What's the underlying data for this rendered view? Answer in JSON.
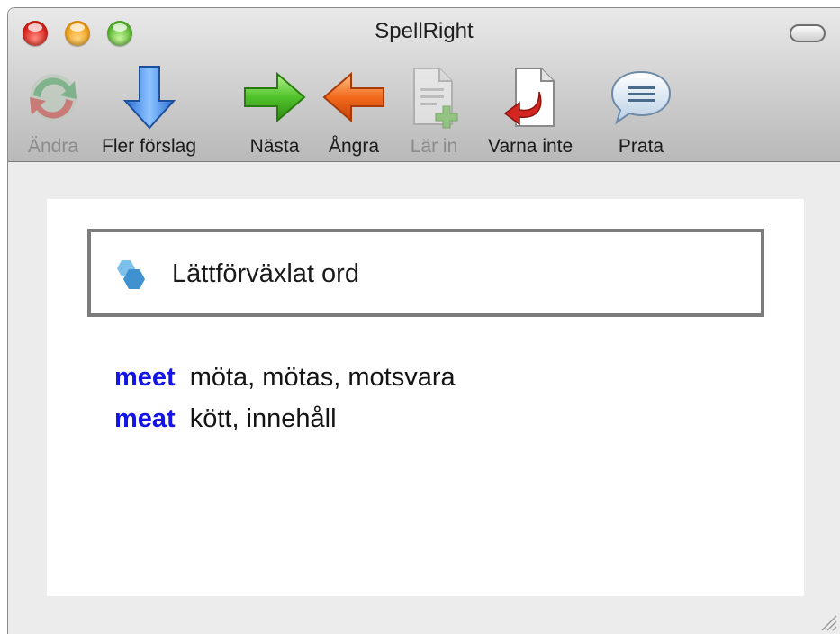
{
  "window": {
    "title": "SpellRight"
  },
  "toolbar": {
    "items": [
      {
        "label": "Ändra",
        "icon": "change-arrows-icon",
        "enabled": false
      },
      {
        "label": "Fler förslag",
        "icon": "down-arrow-icon",
        "enabled": true
      },
      {
        "label": "Nästa",
        "icon": "right-arrow-icon",
        "enabled": true
      },
      {
        "label": "Ångra",
        "icon": "left-arrow-icon",
        "enabled": true
      },
      {
        "label": "Lär in",
        "icon": "add-document-icon",
        "enabled": false
      },
      {
        "label": "Varna inte",
        "icon": "document-arrow-icon",
        "enabled": true
      },
      {
        "label": "Prata",
        "icon": "speech-bubble-icon",
        "enabled": true
      }
    ]
  },
  "panel": {
    "header": "Lättförväxlat ord",
    "header_icon": "hexagon-icon",
    "entries": [
      {
        "word": "meet",
        "translation": "möta, mötas, motsvara"
      },
      {
        "word": "meat",
        "translation": "kött, innehåll"
      }
    ]
  },
  "colors": {
    "word": "#1414e6",
    "header_border": "#7c7c7c",
    "hexagon": "#4a9fd8"
  }
}
